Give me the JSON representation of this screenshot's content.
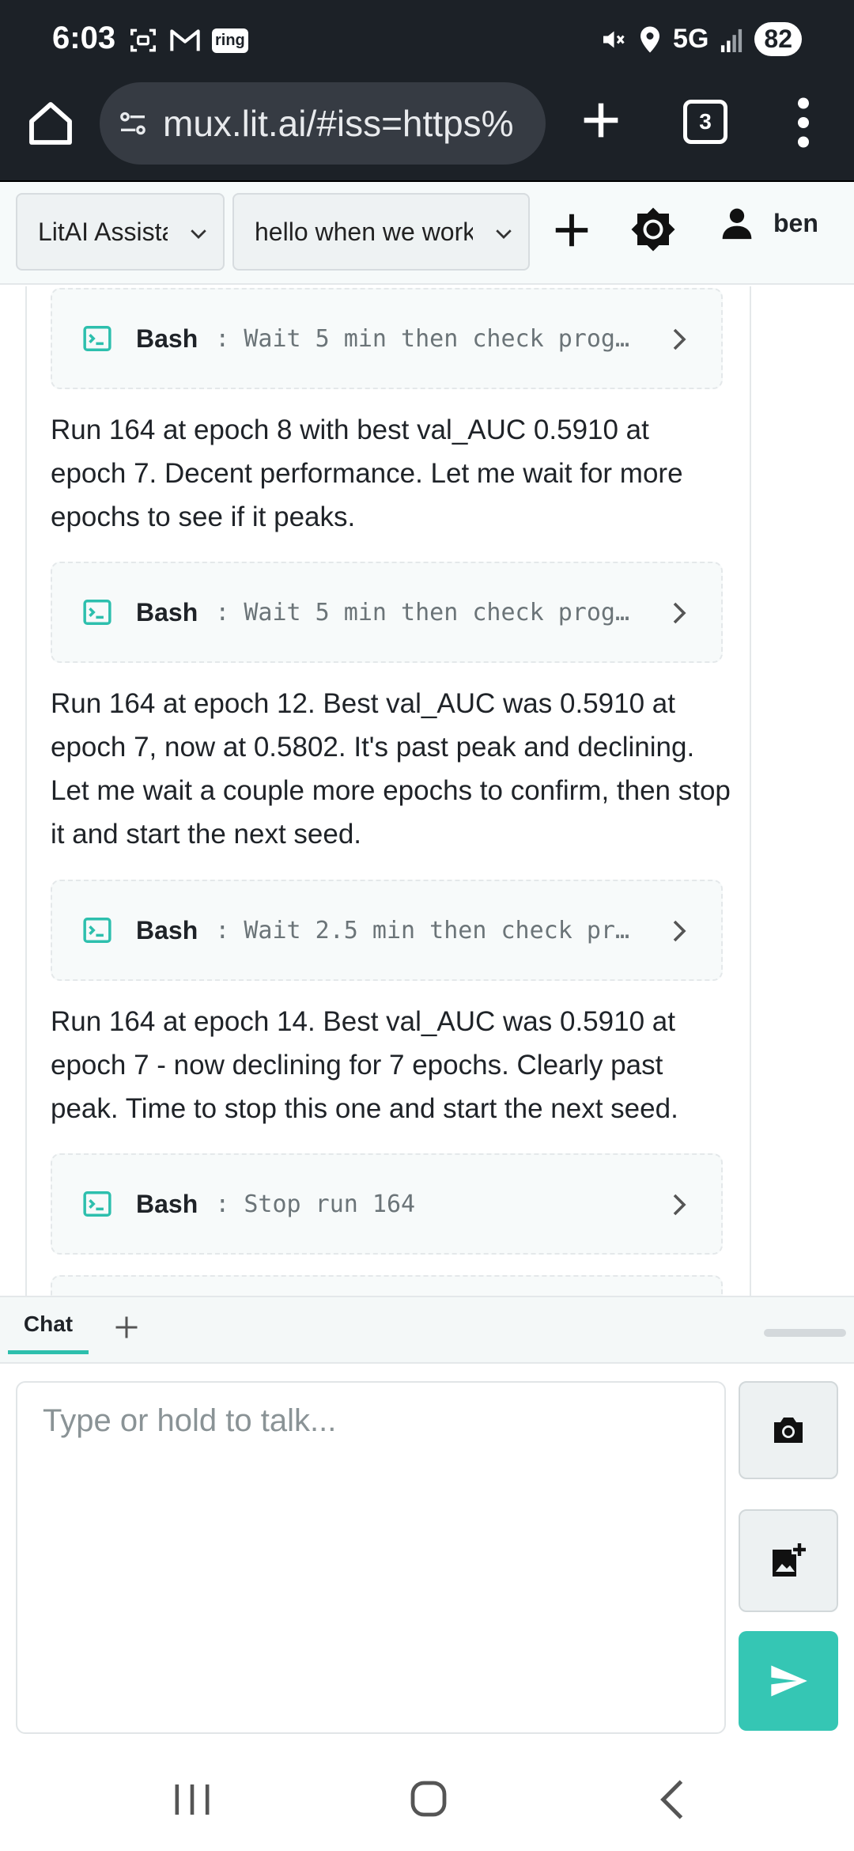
{
  "status_bar": {
    "time": "6:03",
    "network": "5G",
    "battery": "82",
    "ring_badge": "ring",
    "left_icons": [
      "screenshot-icon",
      "gmail-icon",
      "ring-icon"
    ],
    "right_icons": [
      "mute-icon",
      "location-icon",
      "signal-icon"
    ]
  },
  "browser": {
    "url": "mux.lit.ai/#iss=https%",
    "tab_count": "3"
  },
  "header": {
    "assistant_select": "LitAI Assista",
    "conversation_select": "hello when we workir",
    "user_name": "ben"
  },
  "messages": {
    "tool_1": {
      "name": "Bash",
      "desc": ": Wait 5 min then check prog…"
    },
    "text_1": "Run 164 at epoch 8 with best val_AUC 0.5910 at epoch 7. Decent performance. Let me wait for more epochs to see if it peaks.",
    "tool_2": {
      "name": "Bash",
      "desc": ": Wait 5 min then check prog…"
    },
    "text_2": "Run 164 at epoch 12. Best val_AUC was 0.5910 at epoch 7, now at 0.5802. It's past peak and declining. Let me wait a couple more epochs to confirm, then stop it and start the next seed.",
    "tool_3": {
      "name": "Bash",
      "desc": ": Wait 2.5 min then check pr…"
    },
    "text_3": "Run 164 at epoch 14. Best val_AUC was 0.5910 at epoch 7 - now declining for 7 epochs. Clearly past peak. Time to stop this one and start the next seed.",
    "tool_4": {
      "name": "Bash",
      "desc": ": Stop run 164"
    }
  },
  "tabs": {
    "chat_label": "Chat"
  },
  "composer": {
    "placeholder": "Type or hold to talk..."
  },
  "colors": {
    "accent": "#35c6b4",
    "tool_icon": "#2dbfad",
    "system_bar": "#1c2127"
  }
}
